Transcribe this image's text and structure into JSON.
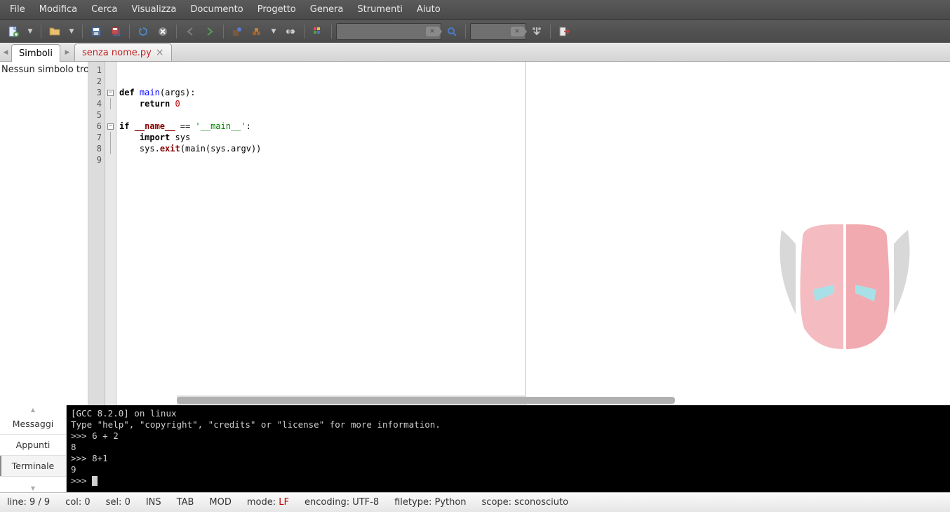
{
  "menu": [
    "File",
    "Modifica",
    "Cerca",
    "Visualizza",
    "Documento",
    "Progetto",
    "Genera",
    "Strumenti",
    "Aiuto"
  ],
  "sidebar": {
    "tab_label": "Simboli",
    "content": "Nessun simbolo trovato"
  },
  "editor_tab": {
    "name": "senza nome.py"
  },
  "code": {
    "lines": [
      {
        "n": 1,
        "raw": ""
      },
      {
        "n": 2,
        "raw": ""
      },
      {
        "n": 3,
        "tokens": [
          [
            "kw",
            "def"
          ],
          [
            "sp",
            " "
          ],
          [
            "fn",
            "main"
          ],
          [
            "op",
            "("
          ],
          [
            "id",
            "args"
          ],
          [
            "op",
            ")"
          ],
          [
            "op",
            ":"
          ]
        ],
        "fold": "open"
      },
      {
        "n": 4,
        "indent": "    ",
        "tokens": [
          [
            "kw",
            "return"
          ],
          [
            "sp",
            " "
          ],
          [
            "num",
            "0"
          ]
        ],
        "fold": "end"
      },
      {
        "n": 5,
        "raw": ""
      },
      {
        "n": 6,
        "tokens": [
          [
            "kw",
            "if"
          ],
          [
            "sp",
            " "
          ],
          [
            "attr",
            "__name__"
          ],
          [
            "sp",
            " "
          ],
          [
            "op",
            "=="
          ],
          [
            "sp",
            " "
          ],
          [
            "str",
            "'__main__'"
          ],
          [
            "op",
            ":"
          ]
        ],
        "fold": "open"
      },
      {
        "n": 7,
        "indent": "    ",
        "tokens": [
          [
            "kw",
            "import"
          ],
          [
            "sp",
            " "
          ],
          [
            "id",
            "sys"
          ]
        ],
        "fold": "mid"
      },
      {
        "n": 8,
        "indent": "    ",
        "tokens": [
          [
            "id",
            "sys"
          ],
          [
            "op",
            "."
          ],
          [
            "attr",
            "exit"
          ],
          [
            "op",
            "("
          ],
          [
            "id",
            "main"
          ],
          [
            "op",
            "("
          ],
          [
            "id",
            "sys"
          ],
          [
            "op",
            "."
          ],
          [
            "id",
            "argv"
          ],
          [
            "op",
            ")"
          ],
          [
            "op",
            ")"
          ]
        ],
        "fold": "end"
      },
      {
        "n": 9,
        "raw": ""
      }
    ]
  },
  "panel": {
    "tabs": [
      "Messaggi",
      "Appunti",
      "Terminale"
    ],
    "active": 2,
    "terminal_lines": [
      "[GCC 8.2.0] on linux",
      "Type \"help\", \"copyright\", \"credits\" or \"license\" for more information.",
      ">>> 6 + 2",
      "8",
      ">>> 8+1",
      "9",
      ">>> "
    ]
  },
  "status": {
    "line": "line: 9 / 9",
    "col": "col: 0",
    "sel": "sel: 0",
    "ins": "INS",
    "tab": "TAB",
    "mod": "MOD",
    "mode_label": "mode: ",
    "mode_value": "LF",
    "encoding": "encoding: UTF-8",
    "filetype": "filetype: Python",
    "scope": "scope: sconosciuto"
  },
  "search": {
    "placeholder": ""
  },
  "goto": {
    "placeholder": ""
  }
}
